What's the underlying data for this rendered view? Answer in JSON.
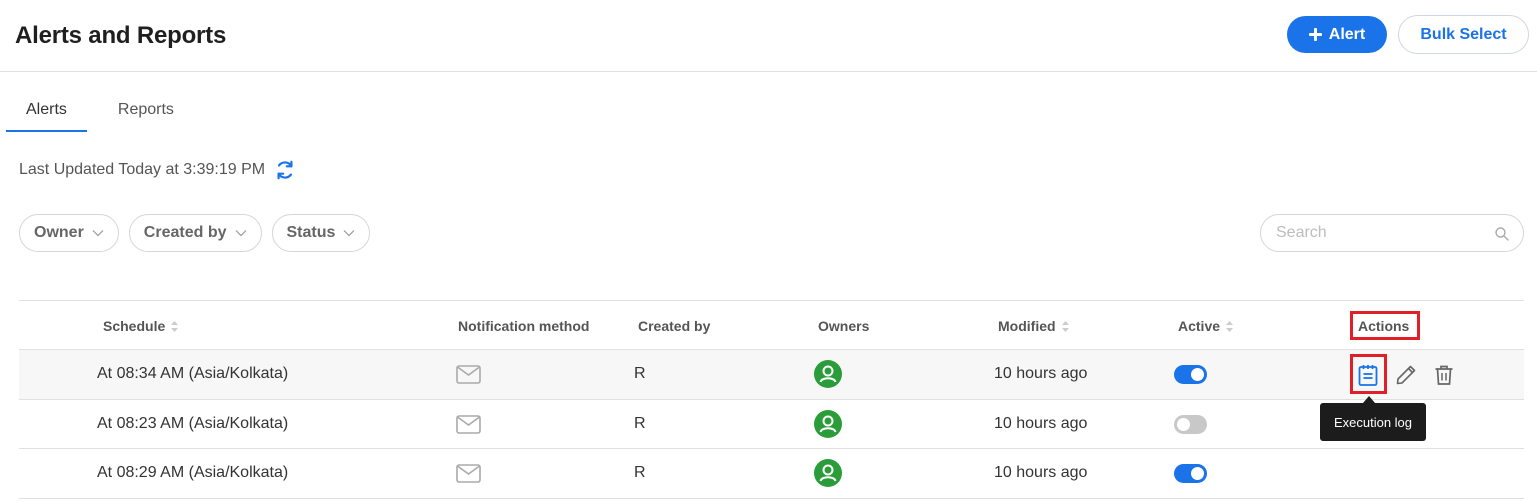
{
  "header": {
    "title": "Alerts and Reports",
    "add_alert_label": "Alert",
    "bulk_select_label": "Bulk Select"
  },
  "tabs": [
    {
      "label": "Alerts",
      "active": true
    },
    {
      "label": "Reports",
      "active": false
    }
  ],
  "last_updated": "Last Updated Today at 3:39:19 PM",
  "filters": [
    {
      "label": "Owner"
    },
    {
      "label": "Created by"
    },
    {
      "label": "Status"
    }
  ],
  "search": {
    "placeholder": "Search",
    "value": ""
  },
  "table": {
    "columns": [
      "Schedule",
      "Notification method",
      "Created by",
      "Owners",
      "Modified",
      "Active",
      "Actions"
    ],
    "rows": [
      {
        "schedule": "At 08:34 AM (Asia/Kolkata)",
        "notification": "mail-icon",
        "created_by": "R",
        "owner": "avatar",
        "modified": "10 hours ago",
        "active": true
      },
      {
        "schedule": "At 08:23 AM (Asia/Kolkata)",
        "notification": "mail-icon",
        "created_by": "R",
        "owner": "avatar",
        "modified": "10 hours ago",
        "active": false
      },
      {
        "schedule": "At 08:29 AM (Asia/Kolkata)",
        "notification": "mail-icon",
        "created_by": "R",
        "owner": "avatar",
        "modified": "10 hours ago",
        "active": true
      }
    ]
  },
  "tooltip": "Execution log",
  "colors": {
    "accent": "#1a73e8",
    "highlight": "#e01f26",
    "avatar": "#2a9d3a"
  }
}
